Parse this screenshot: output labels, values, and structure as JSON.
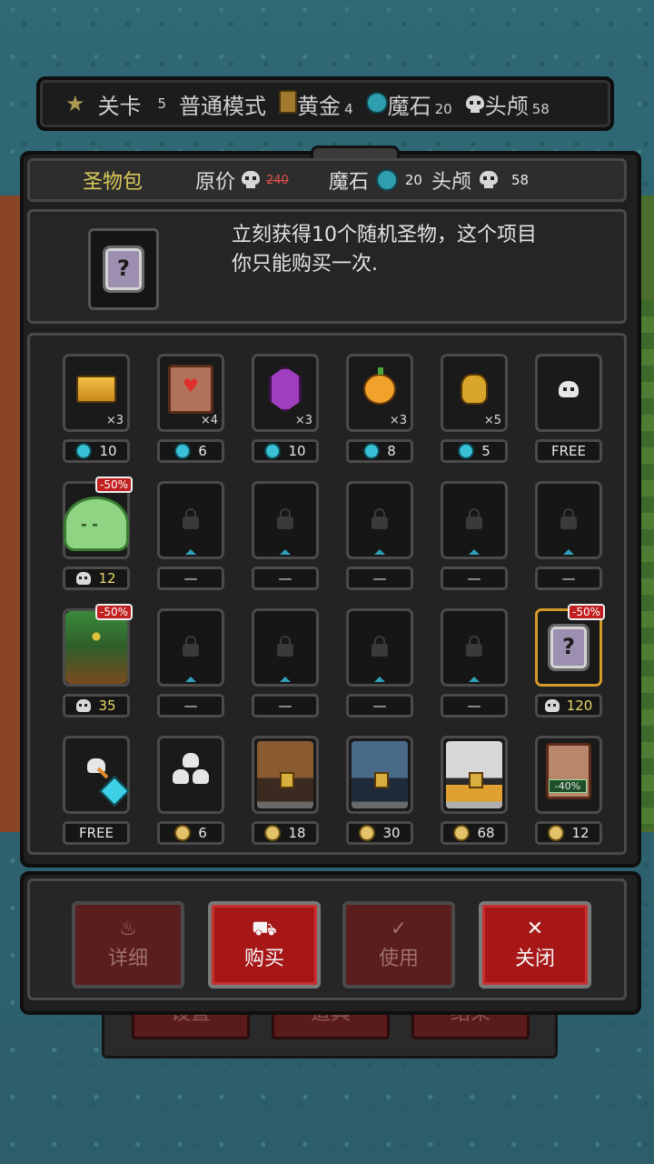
{
  "topbar": {
    "stage_label": "关卡",
    "stage_value": "5",
    "mode_label": "普通模式",
    "gold_label": "黄金",
    "gold_value": "4",
    "gem_label": "魔石",
    "gem_value": "20",
    "skull_label": "头颅",
    "skull_value": "58"
  },
  "header": {
    "title": "圣物包",
    "orig_price_label": "原价",
    "orig_price_value": "240",
    "gem_label": "魔石",
    "gem_value": "20",
    "skull_label": "头颅",
    "skull_value": "58"
  },
  "description": {
    "icon": "mystery-relic-icon",
    "text_line1": "立刻获得10个随机圣物，这个项目",
    "text_line2": "你只能购买一次."
  },
  "grid": {
    "rows": [
      [
        {
          "item": "gold-bars",
          "qty": "×3",
          "currency": "gem",
          "price": "10"
        },
        {
          "item": "heart-scroll",
          "qty": "×4",
          "currency": "gem",
          "price": "6"
        },
        {
          "item": "purple-crystal",
          "qty": "×3",
          "currency": "gem",
          "price": "10"
        },
        {
          "item": "golden-apple",
          "qty": "×3",
          "currency": "gem",
          "price": "8"
        },
        {
          "item": "skull-amulet",
          "qty": "×5",
          "currency": "gem",
          "price": "5"
        },
        {
          "item": "skull",
          "qty": "",
          "currency": "none",
          "price": "FREE"
        }
      ],
      [
        {
          "item": "slime",
          "discount": "-50%",
          "currency": "skull",
          "price": "12"
        },
        {
          "item": "locked",
          "currency": "none",
          "price": "—"
        },
        {
          "item": "locked",
          "currency": "none",
          "price": "—"
        },
        {
          "item": "locked",
          "currency": "none",
          "price": "—"
        },
        {
          "item": "locked",
          "currency": "none",
          "price": "—"
        },
        {
          "item": "locked",
          "currency": "none",
          "price": "—"
        }
      ],
      [
        {
          "item": "treant",
          "discount": "-50%",
          "currency": "skull",
          "price": "35"
        },
        {
          "item": "locked",
          "currency": "none",
          "price": "—"
        },
        {
          "item": "locked",
          "currency": "none",
          "price": "—"
        },
        {
          "item": "locked",
          "currency": "none",
          "price": "—"
        },
        {
          "item": "locked",
          "currency": "none",
          "price": "—"
        },
        {
          "item": "relic-pack",
          "discount": "-50%",
          "currency": "skull",
          "price": "120",
          "selected": true
        }
      ],
      [
        {
          "item": "skull-to-gem",
          "currency": "none",
          "price": "FREE"
        },
        {
          "item": "skull-pile",
          "currency": "coin",
          "price": "6"
        },
        {
          "item": "brown-chest",
          "currency": "coin",
          "price": "18"
        },
        {
          "item": "blue-chest",
          "currency": "coin",
          "price": "30"
        },
        {
          "item": "gold-chest",
          "currency": "coin",
          "price": "68"
        },
        {
          "item": "coupon",
          "coupon_text": "-40%",
          "currency": "coin",
          "price": "12"
        }
      ]
    ]
  },
  "buttons": {
    "details": "详细",
    "buy": "购买",
    "use": "使用",
    "close": "关闭"
  },
  "under_buttons": [
    "设置",
    "道具",
    "结束"
  ]
}
